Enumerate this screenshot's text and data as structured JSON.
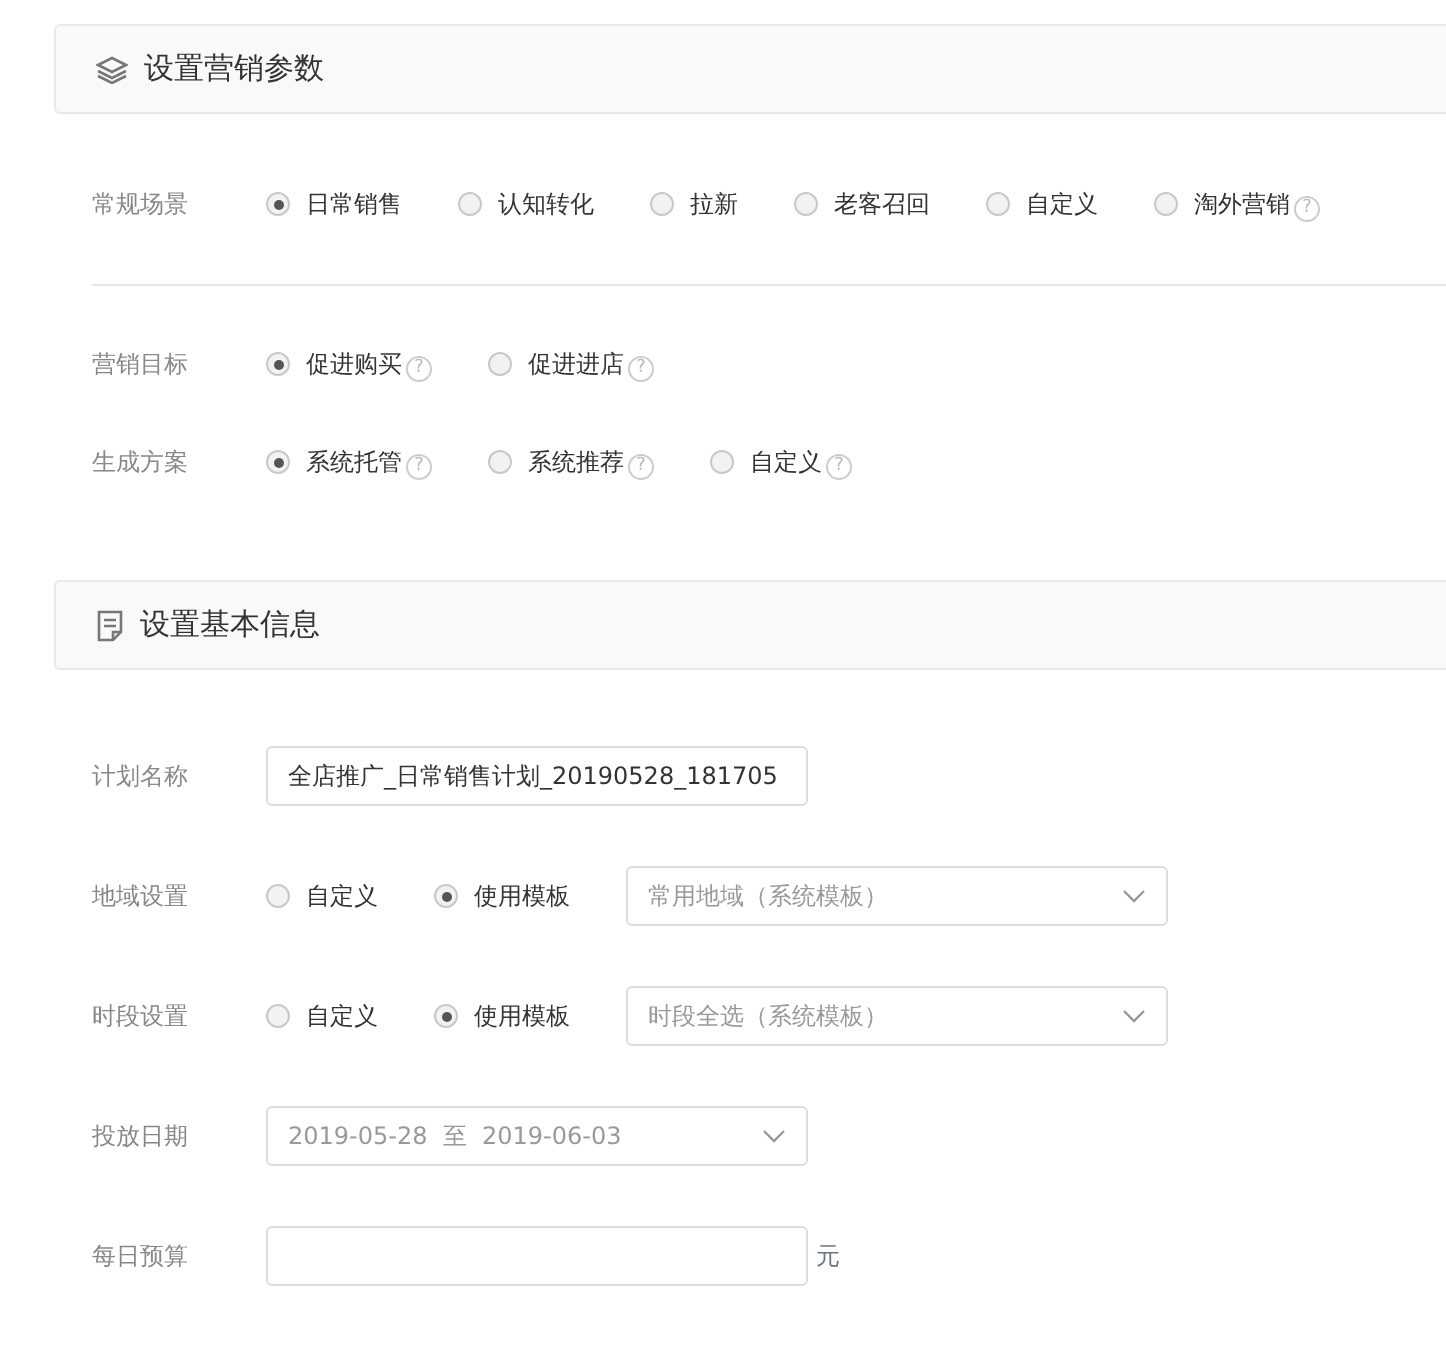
{
  "sections": [
    {
      "title": "设置营销参数",
      "groups": [
        {
          "rows": [
            {
              "kind": "radio",
              "label": "常规场景",
              "options": [
                {
                  "label": "日常销售",
                  "selected": true
                },
                {
                  "label": "认知转化",
                  "selected": false
                },
                {
                  "label": "拉新",
                  "selected": false
                },
                {
                  "label": "老客召回",
                  "selected": false
                },
                {
                  "label": "自定义",
                  "selected": false
                },
                {
                  "label": "淘外营销",
                  "selected": false,
                  "help": "?"
                }
              ]
            }
          ]
        },
        {
          "rows": [
            {
              "kind": "radio",
              "label": "营销目标",
              "options": [
                {
                  "label": "促进购买",
                  "selected": true,
                  "help": "?"
                },
                {
                  "label": "促进进店",
                  "selected": false,
                  "help": "?"
                }
              ]
            },
            {
              "kind": "radio",
              "label": "生成方案",
              "options": [
                {
                  "label": "系统托管",
                  "selected": true,
                  "help": "?"
                },
                {
                  "label": "系统推荐",
                  "selected": false,
                  "help": "?"
                },
                {
                  "label": "自定义",
                  "selected": false,
                  "help": "?"
                }
              ]
            }
          ]
        }
      ]
    },
    {
      "title": "设置基本信息",
      "groups": [
        {
          "rows": [
            {
              "kind": "text",
              "label": "计划名称",
              "value": "全店推广_日常销售计划_20190528_181705"
            },
            {
              "kind": "radio-select",
              "label": "地域设置",
              "options": [
                {
                  "label": "自定义",
                  "selected": false
                },
                {
                  "label": "使用模板",
                  "selected": true
                }
              ],
              "select": "常用地域（系统模板）"
            },
            {
              "kind": "radio-select",
              "label": "时段设置",
              "options": [
                {
                  "label": "自定义",
                  "selected": false
                },
                {
                  "label": "使用模板",
                  "selected": true
                }
              ],
              "select": "时段全选（系统模板）"
            },
            {
              "kind": "date-range",
              "label": "投放日期",
              "start": "2019-05-28",
              "separator": "至",
              "end": "2019-06-03"
            },
            {
              "kind": "amount",
              "label": "每日预算",
              "value": "",
              "unit": "元"
            }
          ]
        }
      ]
    }
  ]
}
